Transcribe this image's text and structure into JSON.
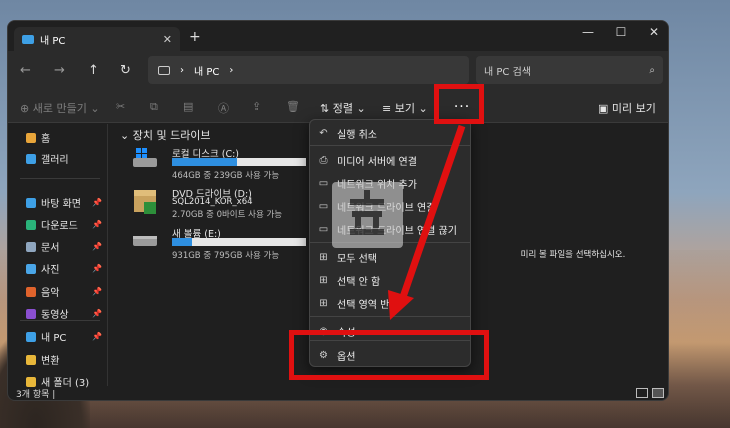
{
  "window": {
    "tab_title": "내 PC",
    "new_tab": "+",
    "tab_close": "✕",
    "minimize": "—",
    "maximize": "☐",
    "close": "✕"
  },
  "address": {
    "path_sep": "›",
    "location": "내 PC",
    "trail": "›",
    "search_placeholder": "내 PC 검색"
  },
  "toolbar": {
    "new_label": "새로 만들기",
    "sort_label": "정렬",
    "view_label": "보기",
    "more_label": "···",
    "details_label": "미리 보기"
  },
  "sidebar": {
    "items": [
      {
        "label": "홈",
        "color": "#e8a53a",
        "pinned": false
      },
      {
        "label": "갤러리",
        "color": "#3ea0e6",
        "pinned": false
      },
      {
        "label": "바탕 화면",
        "color": "#3ea0e6",
        "pinned": true
      },
      {
        "label": "다운로드",
        "color": "#2ab37a",
        "pinned": true
      },
      {
        "label": "문서",
        "color": "#8fa6bf",
        "pinned": true
      },
      {
        "label": "사진",
        "color": "#4aa6e8",
        "pinned": true
      },
      {
        "label": "음악",
        "color": "#e0632c",
        "pinned": true
      },
      {
        "label": "동영상",
        "color": "#8a4fd0",
        "pinned": true
      },
      {
        "label": "내 PC",
        "color": "#3ea0e6",
        "pinned": true
      },
      {
        "label": "변환",
        "color": "#e8b73a",
        "pinned": false
      },
      {
        "label": "새 폴더 (3)",
        "color": "#e8b73a",
        "pinned": false
      }
    ]
  },
  "content": {
    "group_header": "장치 및 드라이브",
    "drives": [
      {
        "name": "로컬 디스크 (C:)",
        "info": "464GB 중 239GB 사용 가능",
        "used_fraction": 0.485
      },
      {
        "name": "DVD 드라이브 (D:)",
        "sub": "SQL2014_KOR_x64",
        "info": "2.70GB 중 0바이트 사용 가능"
      },
      {
        "name": "새 볼륨 (E:)",
        "info": "931GB 중 795GB 사용 가능",
        "used_fraction": 0.146
      }
    ]
  },
  "preview": {
    "text": "미리 볼 파일을 선택하십시오."
  },
  "status": {
    "text": "3개 항목  |"
  },
  "menu": {
    "items": [
      {
        "label": "실행 취소",
        "icon": "↶"
      },
      {
        "label": "미디어 서버에 연결",
        "icon": "⎙"
      },
      {
        "label": "네트워크 위치 추가",
        "icon": "▭"
      },
      {
        "label": "네트워크 드라이브 연결",
        "icon": "▭"
      },
      {
        "label": "네트워크 드라이브 연결 끊기",
        "icon": "▭"
      },
      {
        "label": "모두 선택",
        "icon": "⊞"
      },
      {
        "label": "선택 안 함",
        "icon": "⊞"
      },
      {
        "label": "선택 영역 반전",
        "icon": "⊞"
      },
      {
        "label": "속성",
        "icon": "◉"
      },
      {
        "label": "옵션",
        "icon": "⚙"
      }
    ]
  },
  "colors": {
    "highlight": "#e01010",
    "accent": "#2e8fe0"
  }
}
